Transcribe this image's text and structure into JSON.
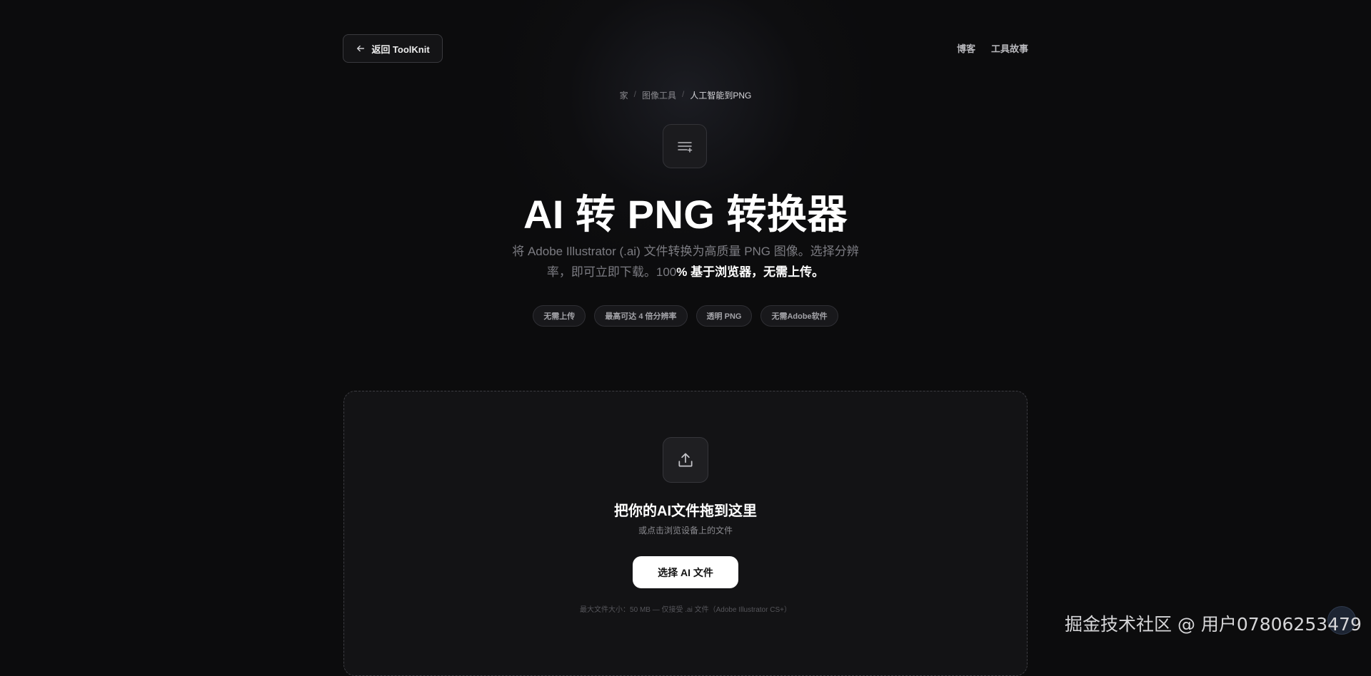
{
  "header": {
    "back_label": "返回 ToolKnit",
    "nav": [
      "博客",
      "工具故事"
    ]
  },
  "breadcrumb": {
    "items": [
      "家",
      "图像工具"
    ],
    "current": "人工智能到PNG",
    "separator": "/"
  },
  "hero": {
    "title": "AI 转 PNG 转换器",
    "subtitle_plain": "将 Adobe Illustrator (.ai) 文件转换为高质量 PNG 图像。选择分辨率，即可立即下载。100",
    "subtitle_strong": "% 基于浏览器，无需上传。",
    "badges": [
      "无需上传",
      "最高可达 4 倍分辨率",
      "透明 PNG",
      "无需Adobe软件"
    ]
  },
  "dropzone": {
    "title": "把你的AI文件拖到这里",
    "subtitle": "或点击浏览设备上的文件",
    "button_label": "选择 AI 文件",
    "note": "最大文件大小：50 MB — 仅接受 .ai 文件（Adobe Illustrator CS+）"
  },
  "watermark": "掘金技术社区 @ 用户07806253479",
  "icons": [
    "arrow-left-icon",
    "list-plus-icon",
    "upload-icon"
  ],
  "colors": {
    "background": "#0c0c0d",
    "primary_button": "#ffffff"
  }
}
